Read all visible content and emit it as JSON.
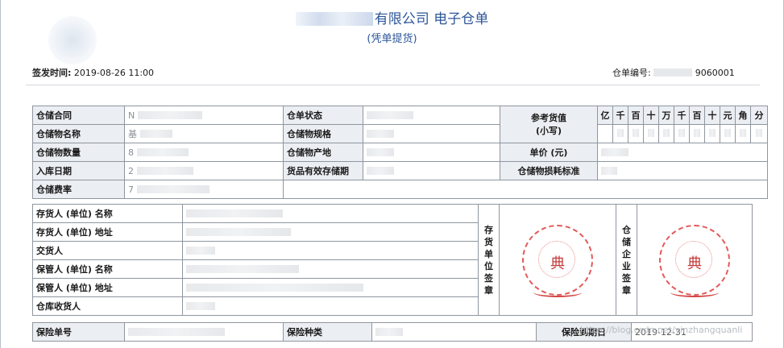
{
  "header": {
    "title": "有限公司  电子仓单",
    "subtitle": "(凭单提货)",
    "issue_label": "签发时间:",
    "issue_time": "2019-08-26 11:00",
    "receipt_no_label": "仓单编号:",
    "receipt_no_tail": "9060001"
  },
  "info": {
    "contract_label": "仓储合同",
    "contract_value": "N",
    "status_label": "仓单状态",
    "ref_value_label": "参考货值",
    "ref_value_sub": "(小写)",
    "goods_name_label": "仓储物名称",
    "goods_name_value": "基",
    "spec_label": "仓储物规格",
    "goods_qty_label": "仓储物数量",
    "goods_qty_value": "8",
    "origin_label": "仓储物产地",
    "unit_price_label": "单价 (元)",
    "in_date_label": "入库日期",
    "in_date_value": "2",
    "validity_label": "货品有效存储期",
    "loss_label": "仓储物损耗标准",
    "fee_label": "仓储费率",
    "fee_value": "7"
  },
  "digits": [
    "亿",
    "千",
    "百",
    "十",
    "万",
    "千",
    "百",
    "十",
    "元",
    "角",
    "分"
  ],
  "parties": {
    "depositor_name_label": "存货人 (单位) 名称",
    "depositor_addr_label": "存货人 (单位) 地址",
    "deliverer_label": "交货人",
    "keeper_name_label": "保管人 (单位) 名称",
    "keeper_addr_label": "保管人 (单位) 地址",
    "receiver_label": "仓库收货人",
    "depositor_seal_label": "存货单位签章",
    "storage_seal_label": "仓储企业签章",
    "seal_char": "典"
  },
  "insurance": {
    "policy_no_label": "保险单号",
    "type_label": "保险种类",
    "expiry_label": "保险到期日",
    "expiry_value": "2019-12-31"
  },
  "watermark": "https://blog.csdn.net/yinzhangquanli",
  "colors": {
    "title": "#2c5699",
    "label_bg": "#ebeef2",
    "border": "#8f969f",
    "seal": "#e25a5a"
  }
}
